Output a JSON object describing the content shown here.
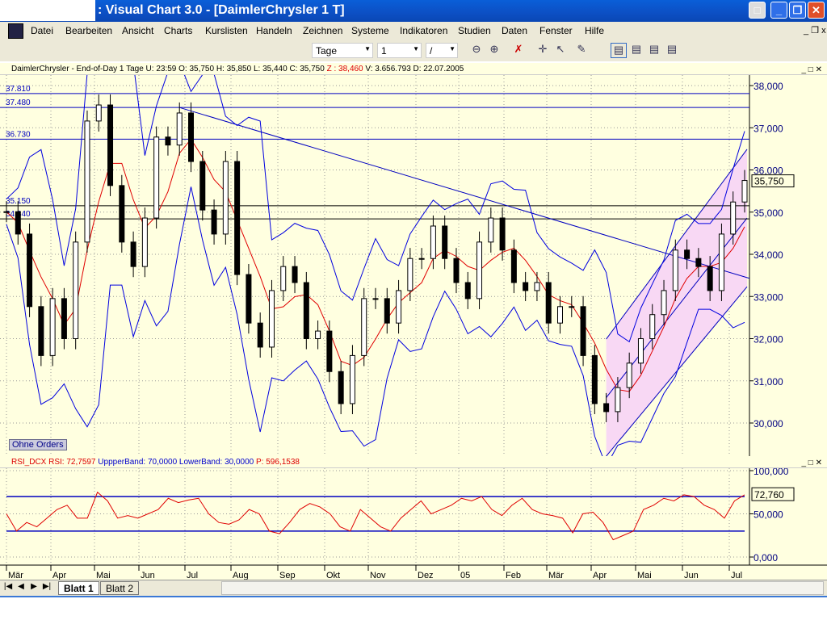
{
  "window": {
    "title": ": Visual Chart  3.0 - [DaimlerChrysler 1 T]"
  },
  "menu": [
    "Datei",
    "Bearbeiten",
    "Ansicht",
    "Charts",
    "Kurslisten",
    "Handeln",
    "Zeichnen",
    "Systeme",
    "Indikatoren",
    "Studien",
    "Daten",
    "Fenster",
    "Hilfe"
  ],
  "toolbar": {
    "period": "Tage",
    "multiplier": "1",
    "line_style": "/"
  },
  "chart_header": {
    "text": "DaimlerChrysler - End-of-Day 1 Tage  U: 23:59  O: 35,750  H: 35,850  L: 35,440  C: 35,750 ",
    "z": " Z : 38,460 ",
    "rest": " V: 3.656.793  D: 22.07.2005"
  },
  "rsi_header": {
    "a": "RSI_DCX  RSI: 72,7597  ",
    "b": "UppperBand: 70,0000  LowerBand: 30,0000  ",
    "c": "P: 596,1538"
  },
  "badge": "Ohne Orders",
  "tabs": [
    "Blatt 1",
    "Blatt 2"
  ],
  "colors": {
    "price": "#000000",
    "ma": "#e00000",
    "bands": "#0000e0",
    "hlines": "#000000",
    "trend": "#0000c0",
    "channel_fill": "#f8d8f4",
    "rsi": "#e00000",
    "bg": "#ffffe0"
  },
  "chart_data": {
    "type": "candlestick",
    "price_axis": {
      "ticks": [
        "38,000",
        "37,000",
        "36,000",
        "35,000",
        "34,000",
        "33,000",
        "32,000",
        "31,000",
        "30,000"
      ],
      "ylim": [
        29200,
        38200
      ]
    },
    "last_price": "35,750",
    "x_ticks": [
      "Mär",
      "Apr",
      "Mai",
      "Jun",
      "Jul",
      "Aug",
      "Sep",
      "Okt",
      "Nov",
      "Dez",
      "05",
      "Feb",
      "Mär",
      "Apr",
      "Mai",
      "Jun",
      "Jul"
    ],
    "closes": [
      35010,
      34480,
      32760,
      31600,
      32950,
      32000,
      34290,
      37160,
      37540,
      35630,
      34290,
      33710,
      34860,
      36780,
      36590,
      37350,
      36200,
      35050,
      34480,
      36200,
      33520,
      32370,
      31800,
      33140,
      33710,
      33330,
      32000,
      32180,
      31220,
      30460,
      31600,
      32950,
      32950,
      32370,
      33140,
      33900,
      33900,
      34670,
      33900,
      33330,
      32950,
      34290,
      34860,
      34100,
      33330,
      33140,
      33330,
      32370,
      32760,
      32760,
      31600,
      30460,
      30270,
      30840,
      31420,
      32000,
      32570,
      33140,
      34100,
      33900,
      33710,
      33140,
      34480,
      35240,
      35750
    ],
    "hlines": [
      {
        "label": "37.810",
        "value": 37810
      },
      {
        "label": "37.480",
        "value": 37480
      },
      {
        "label": "36.730",
        "value": 36730
      },
      {
        "label": "35.150",
        "value": 35150
      },
      {
        "label": "34.840",
        "value": 34840
      }
    ],
    "trendline": {
      "from_index": 15,
      "from": 37480,
      "to": 33430
    },
    "channel": {
      "start_index": 52,
      "upper": [
        31990,
        36490
      ],
      "lower": [
        29215,
        33230
      ]
    },
    "rsi": {
      "ticks": [
        "100,000",
        "50,000",
        "0,000"
      ],
      "upper": 70,
      "lower": 30,
      "last": "72,760",
      "values": [
        50,
        30,
        40,
        35,
        45,
        55,
        60,
        45,
        45,
        75,
        65,
        45,
        48,
        45,
        50,
        55,
        68,
        63,
        66,
        68,
        50,
        40,
        38,
        43,
        55,
        50,
        30,
        27,
        40,
        55,
        62,
        58,
        50,
        35,
        30,
        55,
        45,
        35,
        30,
        45,
        55,
        65,
        50,
        55,
        60,
        68,
        65,
        70,
        55,
        48,
        60,
        68,
        55,
        50,
        48,
        45,
        28,
        50,
        52,
        40,
        20,
        25,
        30,
        55,
        60,
        68,
        65,
        72,
        70,
        60,
        55,
        45,
        65,
        72
      ]
    }
  }
}
